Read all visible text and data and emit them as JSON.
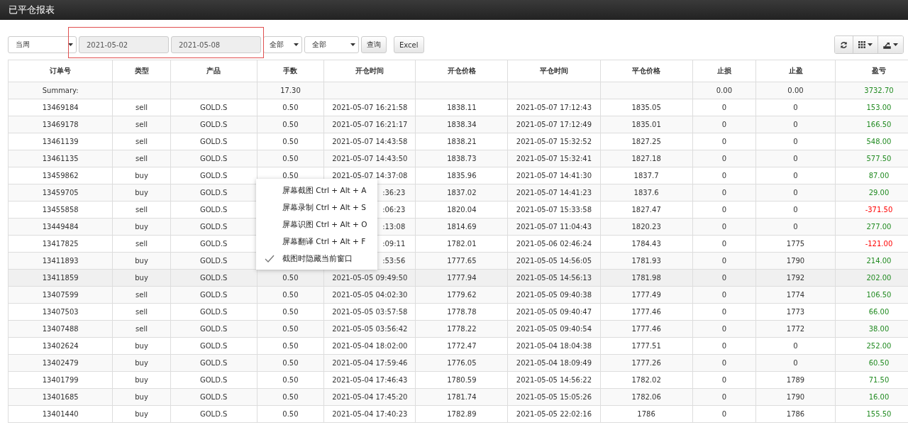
{
  "header": {
    "title": "已平仓报表"
  },
  "filters": {
    "period": "当周",
    "date_from": "2021-05-02",
    "date_to": "2021-05-08",
    "select_1": "全部",
    "select_2": "全部",
    "query_button": "查询",
    "excel_button": "Excel",
    "highlighted": true
  },
  "table": {
    "columns": [
      "订单号",
      "类型",
      "产品",
      "手数",
      "开仓时间",
      "开仓价格",
      "平仓时间",
      "平仓价格",
      "止损",
      "止盈",
      "盈亏"
    ],
    "summary": {
      "label": "Summary:",
      "lots": "17.30",
      "sl": "0.00",
      "tp": "0.00",
      "profit": "3732.70",
      "color": "#228b22"
    },
    "rows": [
      {
        "order_no": "13469184",
        "type": "sell",
        "product": "GOLD.S",
        "lots": "0.50",
        "open_time": "2021-05-07 16:21:58",
        "open_price": "1838.11",
        "close_time": "2021-05-07 17:12:43",
        "close_price": "1835.05",
        "sl": "0",
        "tp": "0",
        "profit": "153.00",
        "color": "#228b22"
      },
      {
        "order_no": "13469178",
        "type": "sell",
        "product": "GOLD.S",
        "lots": "0.50",
        "open_time": "2021-05-07 16:21:17",
        "open_price": "1838.34",
        "close_time": "2021-05-07 17:12:49",
        "close_price": "1835.01",
        "sl": "0",
        "tp": "0",
        "profit": "166.50",
        "color": "#228b22"
      },
      {
        "order_no": "13461139",
        "type": "sell",
        "product": "GOLD.S",
        "lots": "0.50",
        "open_time": "2021-05-07 14:43:58",
        "open_price": "1838.21",
        "close_time": "2021-05-07 15:32:52",
        "close_price": "1827.25",
        "sl": "0",
        "tp": "0",
        "profit": "548.00",
        "color": "#228b22"
      },
      {
        "order_no": "13461135",
        "type": "sell",
        "product": "GOLD.S",
        "lots": "0.50",
        "open_time": "2021-05-07 14:43:50",
        "open_price": "1838.73",
        "close_time": "2021-05-07 15:32:41",
        "close_price": "1827.18",
        "sl": "0",
        "tp": "0",
        "profit": "577.50",
        "color": "#228b22"
      },
      {
        "order_no": "13459862",
        "type": "buy",
        "product": "GOLD.S",
        "lots": "0.50",
        "open_time": "2021-05-07 14:37:08",
        "open_price": "1835.96",
        "close_time": "2021-05-07 14:41:30",
        "close_price": "1837.7",
        "sl": "0",
        "tp": "0",
        "profit": "87.00",
        "color": "#228b22"
      },
      {
        "order_no": "13459705",
        "type": "buy",
        "product": "GOLD.S",
        "open_time": ":36:23",
        "covered": true,
        "open_price": "1837.02",
        "close_time": "2021-05-07 14:41:23",
        "close_price": "1837.6",
        "sl": "0",
        "tp": "0",
        "profit": "29.00",
        "color": "#228b22"
      },
      {
        "order_no": "13455858",
        "type": "sell",
        "product": "GOLD.S",
        "open_time": ":06:23",
        "covered": true,
        "open_price": "1820.04",
        "close_time": "2021-05-07 15:33:58",
        "close_price": "1827.47",
        "sl": "0",
        "tp": "0",
        "profit": "-371.50",
        "color": "#ff0000"
      },
      {
        "order_no": "13449484",
        "type": "buy",
        "product": "GOLD.S",
        "open_time": ":13:08",
        "covered": true,
        "open_price": "1814.69",
        "close_time": "2021-05-07 11:04:43",
        "close_price": "1820.23",
        "sl": "0",
        "tp": "0",
        "profit": "277.00",
        "color": "#228b22"
      },
      {
        "order_no": "13417825",
        "type": "sell",
        "product": "GOLD.S",
        "open_time": ":09:11",
        "covered": true,
        "open_price": "1782.01",
        "close_time": "2021-05-06 02:46:24",
        "close_price": "1784.43",
        "sl": "0",
        "tp": "1775",
        "profit": "-121.00",
        "color": "#ff0000"
      },
      {
        "order_no": "13411893",
        "type": "buy",
        "product": "GOLD.S",
        "open_time": ":53:56",
        "covered": true,
        "open_price": "1777.65",
        "close_time": "2021-05-05 14:56:05",
        "close_price": "1781.93",
        "sl": "0",
        "tp": "1790",
        "profit": "214.00",
        "color": "#228b22"
      },
      {
        "order_no": "13411859",
        "type": "buy",
        "product": "GOLD.S",
        "lots": "0.50",
        "open_time": "2021-05-05 09:49:50",
        "open_price": "1777.94",
        "close_time": "2021-05-05 14:56:13",
        "close_price": "1781.98",
        "sl": "0",
        "tp": "1792",
        "profit": "202.00",
        "color": "#228b22",
        "hovered": true
      },
      {
        "order_no": "13407599",
        "type": "sell",
        "product": "GOLD.S",
        "lots": "0.50",
        "open_time": "2021-05-05 04:02:30",
        "open_price": "1779.62",
        "close_time": "2021-05-05 09:40:38",
        "close_price": "1777.49",
        "sl": "0",
        "tp": "1774",
        "profit": "106.50",
        "color": "#228b22"
      },
      {
        "order_no": "13407503",
        "type": "sell",
        "product": "GOLD.S",
        "lots": "0.50",
        "open_time": "2021-05-05 03:57:58",
        "open_price": "1778.78",
        "close_time": "2021-05-05 09:40:47",
        "close_price": "1777.46",
        "sl": "0",
        "tp": "1773",
        "profit": "66.00",
        "color": "#228b22"
      },
      {
        "order_no": "13407488",
        "type": "sell",
        "product": "GOLD.S",
        "lots": "0.50",
        "open_time": "2021-05-05 03:56:42",
        "open_price": "1778.22",
        "close_time": "2021-05-05 09:40:54",
        "close_price": "1777.46",
        "sl": "0",
        "tp": "1772",
        "profit": "38.00",
        "color": "#228b22"
      },
      {
        "order_no": "13402624",
        "type": "buy",
        "product": "GOLD.S",
        "lots": "0.50",
        "open_time": "2021-05-04 18:02:00",
        "open_price": "1772.47",
        "close_time": "2021-05-04 18:04:38",
        "close_price": "1777.51",
        "sl": "0",
        "tp": "0",
        "profit": "252.00",
        "color": "#228b22"
      },
      {
        "order_no": "13402479",
        "type": "buy",
        "product": "GOLD.S",
        "lots": "0.50",
        "open_time": "2021-05-04 17:59:46",
        "open_price": "1776.05",
        "close_time": "2021-05-04 18:09:49",
        "close_price": "1777.26",
        "sl": "0",
        "tp": "0",
        "profit": "60.50",
        "color": "#228b22"
      },
      {
        "order_no": "13401799",
        "type": "buy",
        "product": "GOLD.S",
        "lots": "0.50",
        "open_time": "2021-05-04 17:46:43",
        "open_price": "1780.59",
        "close_time": "2021-05-05 14:56:22",
        "close_price": "1782.02",
        "sl": "0",
        "tp": "1789",
        "profit": "71.50",
        "color": "#228b22"
      },
      {
        "order_no": "13401685",
        "type": "buy",
        "product": "GOLD.S",
        "lots": "0.50",
        "open_time": "2021-05-04 17:45:20",
        "open_price": "1781.74",
        "close_time": "2021-05-05 15:05:26",
        "close_price": "1782.06",
        "sl": "0",
        "tp": "1790",
        "profit": "16.00",
        "color": "#228b22"
      },
      {
        "order_no": "13401440",
        "type": "buy",
        "product": "GOLD.S",
        "lots": "0.50",
        "open_time": "2021-05-04 17:40:23",
        "open_price": "1782.89",
        "close_time": "2021-05-05 22:02:16",
        "close_price": "1786",
        "sl": "0",
        "tp": "1786",
        "profit": "155.50",
        "color": "#228b22"
      }
    ]
  },
  "context_menu": {
    "items": [
      {
        "label": "屏幕截图 Ctrl + Alt + A",
        "checked": false
      },
      {
        "label": "屏幕录制 Ctrl + Alt + S",
        "checked": false
      },
      {
        "label": "屏幕识图 Ctrl + Alt + O",
        "checked": false
      },
      {
        "label": "屏幕翻译 Ctrl + Alt + F",
        "checked": false
      },
      {
        "label": "截图时隐藏当前窗口",
        "checked": true
      }
    ]
  }
}
